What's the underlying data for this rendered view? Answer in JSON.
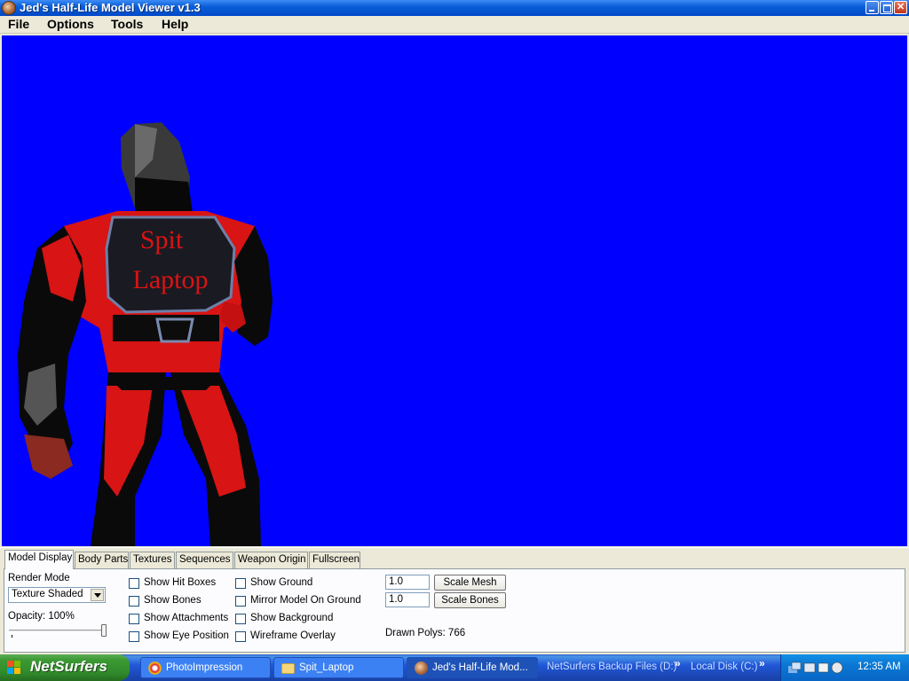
{
  "window": {
    "title": "Jed's Half-Life Model Viewer v1.3",
    "icon": "hl-viewer-app-icon",
    "controls": [
      "minimize-icon",
      "maximize-icon",
      "close-icon"
    ]
  },
  "menu": {
    "file": "File",
    "options": "Options",
    "tools": "Tools",
    "help": "Help"
  },
  "viewport": {
    "background_color": "#0000ff",
    "model_text_line1": "Spit",
    "model_text_line2": "Laptop",
    "model_colors": {
      "primary": "#d81414",
      "secondary": "#050505",
      "hair": "#3a3a3a"
    }
  },
  "tabs": {
    "model_display": "Model Display",
    "body_parts": "Body Parts",
    "textures": "Textures",
    "sequences": "Sequences",
    "weapon_origin": "Weapon Origin",
    "fullscreen": "Fullscreen",
    "active": "Model Display"
  },
  "model_display": {
    "render_mode_label": "Render Mode",
    "render_mode_value": "Texture Shaded",
    "opacity_label": "Opacity: 100%",
    "opacity_value": 100,
    "checkboxes": {
      "show_hit_boxes": "Show Hit Boxes",
      "show_bones": "Show Bones",
      "show_attachments": "Show Attachments",
      "show_eye_position": "Show Eye Position",
      "show_ground": "Show Ground",
      "mirror_model_on_ground": "Mirror Model On Ground",
      "show_background": "Show Background",
      "wireframe_overlay": "Wireframe Overlay"
    },
    "scale_mesh_value": "1.0",
    "scale_mesh_button": "Scale Mesh",
    "scale_bones_value": "1.0",
    "scale_bones_button": "Scale Bones",
    "drawn_polys": "Drawn Polys: 766"
  },
  "taskbar": {
    "start_label": "NetSurfers",
    "tasks": {
      "photoimpression": "PhotoImpression",
      "spit_laptop": "Spit_Laptop",
      "hl_viewer": "Jed's Half-Life Mod..."
    },
    "quick_links": {
      "netsurfers_backup": "NetSurfers Backup Files (D:)",
      "local_disk": "Local Disk (C:)"
    },
    "clock": "12:35 AM"
  }
}
